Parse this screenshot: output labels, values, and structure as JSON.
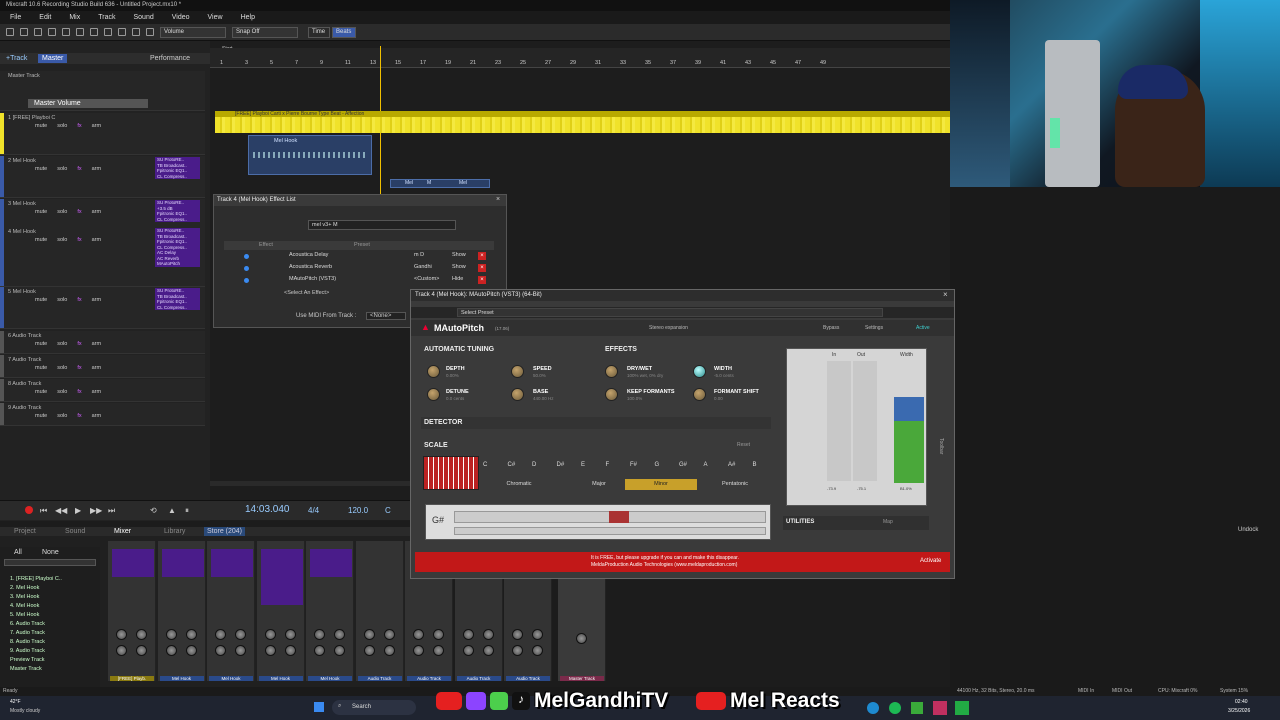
{
  "window": {
    "title": "Mixcraft 10.6 Recording Studio Build 636 - Untitled Project.mx10 *"
  },
  "menu": [
    "File",
    "Edit",
    "Mix",
    "Track",
    "Sound",
    "Video",
    "View",
    "Help"
  ],
  "toolbar": {
    "volume_label": "Volume",
    "snap_label": "Snap Off",
    "time_label": "Time",
    "beats_label": "Beats"
  },
  "track_panel": {
    "add_track": "+Track",
    "master": "Master",
    "performance": "Performance",
    "master_track": "Master Track",
    "master_volume": "Master Volume",
    "arm": "arm"
  },
  "tracks": [
    {
      "name": "1 [FREE] Playboi C",
      "fx": []
    },
    {
      "name": "2 Mel Hook",
      "fx": [
        "SU ProtoRE..",
        "TB Broadcast..",
        "Fpitronic EQ1..",
        "CL Compress.."
      ]
    },
    {
      "name": "3 Mel Hook",
      "fx": [
        "SU ProtoRE..",
        "+3.5 dB",
        "Fpitronic EQ1..",
        "CL Compress.."
      ]
    },
    {
      "name": "4 Mel Hook",
      "fx": [
        "SU ProtoRE..",
        "TB Broadcast..",
        "Fpitronic EQ1..",
        "CL Compress..",
        "AC Delay",
        "AC Reverb",
        "MAutoPitch"
      ]
    },
    {
      "name": "5 Mel Hook",
      "fx": [
        "SU ProtoRE..",
        "TB Broadcast..",
        "Fpitronic EQ1..",
        "CL Compress.."
      ]
    },
    {
      "name": "6 Audio Track",
      "fx": []
    },
    {
      "name": "7 Audio Track",
      "fx": []
    },
    {
      "name": "8 Audio Track",
      "fx": []
    },
    {
      "name": "9 Audio Track",
      "fx": []
    }
  ],
  "track_buttons": {
    "mute": "mute",
    "solo": "solo",
    "fx": "fx",
    "arm": "arm"
  },
  "timeline": {
    "start_label": "Start",
    "tempo_label": "120.0 4/4 C",
    "ruler": [
      "1",
      "3",
      "5",
      "7",
      "9",
      "11",
      "13",
      "15",
      "17",
      "19",
      "21",
      "23",
      "25",
      "27",
      "29",
      "31",
      "33",
      "35",
      "37",
      "39",
      "41",
      "43",
      "45",
      "47",
      "49"
    ],
    "clip1": "[FREE] Playboi Carti x Pierre Bourne Type Beat - Affection",
    "clip2": "Mel Hook",
    "clip3": "Mel",
    "clip4": "M",
    "clip5": "Mel"
  },
  "effect_list": {
    "title": "Track 4 (Mel Hook) Effect List",
    "preset": "mel v3+ M",
    "col_effect": "Effect",
    "col_preset": "Preset",
    "rows": [
      {
        "effect": "Acoustica Delay",
        "preset": "m D",
        "action": "Show"
      },
      {
        "effect": "Acoustica Reverb",
        "preset": "Gandhi",
        "action": "Show"
      },
      {
        "effect": "MAutoPitch (VST3)",
        "preset": "<Custom>",
        "action": "Hide"
      }
    ],
    "select_effect": "<Select An Effect>",
    "midi_label": "Use MIDI From Track :",
    "midi_value": "<None>"
  },
  "autopitch": {
    "window_title": "Track 4 (Mel Hook): MAutoPitch (VST3) (64-Bit)",
    "select_preset": "Select Preset",
    "name": "MAutoPitch",
    "version": "(17.06)",
    "stereo": "Stereo expansion",
    "bypass": "Bypass",
    "settings": "Settings",
    "active": "Active",
    "automatic_tuning": "AUTOMATIC TUNING",
    "effects": "EFFECTS",
    "depth": "DEPTH",
    "depth_val": "0.00%",
    "speed": "SPEED",
    "speed_val": "50.0%",
    "detune": "DETUNE",
    "detune_val": "0.0 cents",
    "base": "BASE",
    "base_val": "440.00 Hz",
    "drywet": "DRY/WET",
    "drywet_val": "100% wet, 0% dry",
    "width": "WIDTH",
    "width_val": "-5.0 cents",
    "keep_formants": "KEEP FORMANTS",
    "keep_val": "100.0%",
    "formant_shift": "FORMANT SHIFT",
    "formant_val": "0.00",
    "detector": "DETECTOR",
    "scale": "SCALE",
    "reset": "Reset",
    "notes": [
      "C",
      "C#",
      "D",
      "D#",
      "E",
      "F",
      "F#",
      "G",
      "G#",
      "A",
      "A#",
      "B"
    ],
    "scales": [
      "Chromatic",
      "Major",
      "Minor",
      "Pentatonic"
    ],
    "selected_scale": "Minor",
    "current_note": "G#",
    "utilities": "UTILITIES",
    "map": "Map",
    "meter_in": "In",
    "meter_out": "Out",
    "meter_width": "Width",
    "meter_vals": [
      "-73.9",
      "-75.1",
      "B1.0%"
    ],
    "footer1": "It is FREE, but please upgrade if you can and make this disappear.",
    "footer2": "MeldaProduction Audio Technologies (www.meldaproduction.com)",
    "activate": "Activate"
  },
  "transport": {
    "time": "14:03.040",
    "sig": "4/4",
    "tempo": "120.0",
    "key": "C"
  },
  "mixer": {
    "tabs": [
      "Project",
      "Sound",
      "Mixer",
      "Library",
      "Store (204)"
    ],
    "filter_all": "All",
    "filter_none": "None",
    "list": [
      "1. [FREE] Playboi C..",
      "2. Mel Hook",
      "3. Mel Hook",
      "4. Mel Hook",
      "5. Mel Hook",
      "6. Audio Track",
      "7. Audio Track",
      "8. Audio Track",
      "9. Audio Track",
      "Preview Track",
      "Master Track"
    ],
    "strips": [
      "[FREE] Playb.",
      "Mel Hook",
      "Mel Hook",
      "Mel Hook",
      "Mel Hook",
      "Audio Track",
      "Audio Track",
      "Audio Track",
      "Audio Track"
    ],
    "master": "Master Track"
  },
  "status": {
    "ready": "Ready",
    "info": "44100 Hz, 32 Bits, Stereo, 20.0 ms",
    "midi_in": "MIDI In",
    "midi_out": "MIDI Out",
    "cpu": "CPU: Mixcraft 0%",
    "system": "System 15%",
    "undock": "Undock"
  },
  "taskbar": {
    "weather_temp": "42°F",
    "weather_desc": "Mostly cloudy",
    "search": "Search",
    "time": "02:40",
    "date": "3/25/2026"
  },
  "social": {
    "handle1": "MelGandhiTV",
    "handle2": "Mel Reacts"
  }
}
